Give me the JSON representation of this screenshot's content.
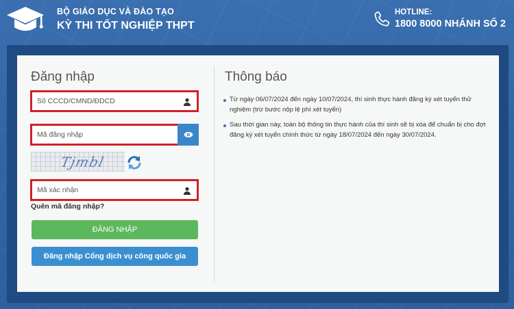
{
  "header": {
    "org_name": "BỘ GIÁO DỤC VÀ ĐÀO TẠO",
    "exam_name": "KỲ THI TỐT NGHIỆP THPT",
    "hotline_label": "HOTLINE:",
    "hotline_number": "1800 8000 NHÁNH SỐ 2"
  },
  "login": {
    "title": "Đăng nhập",
    "id_field": {
      "placeholder": "Số CCCD/CMND/ĐDCD",
      "value": ""
    },
    "password_field": {
      "placeholder": "Mã đăng nhập",
      "value": ""
    },
    "captcha_text": "Tjmbl",
    "captcha_field": {
      "placeholder": "Mã xác nhận",
      "value": ""
    },
    "forgot_label": "Quên mã đăng nhập?",
    "login_button": "ĐĂNG NHẬP",
    "portal_button": "Đăng nhập Cổng dịch vụ công quốc gia"
  },
  "notice": {
    "title": "Thông báo",
    "items": [
      "Từ ngày 06/07/2024 đến ngày 10/07/2024, thí sinh thực hành đăng ký xét tuyển thử nghiệm (trừ bước nộp lệ phí xét tuyển)",
      "Sau thời gian này, toàn bộ thông tin thực hành của thí sinh sẽ bị xóa để chuẩn bị cho đợt đăng ký xét tuyển chính thức từ ngày 18/07/2024 đến ngày 30/07/2024."
    ]
  },
  "colors": {
    "brand_blue": "#3a6fb0",
    "panel_dark": "#1f4b82",
    "highlight_red": "#d0202a",
    "login_green": "#5cb85c",
    "portal_blue": "#3a8fd0"
  }
}
